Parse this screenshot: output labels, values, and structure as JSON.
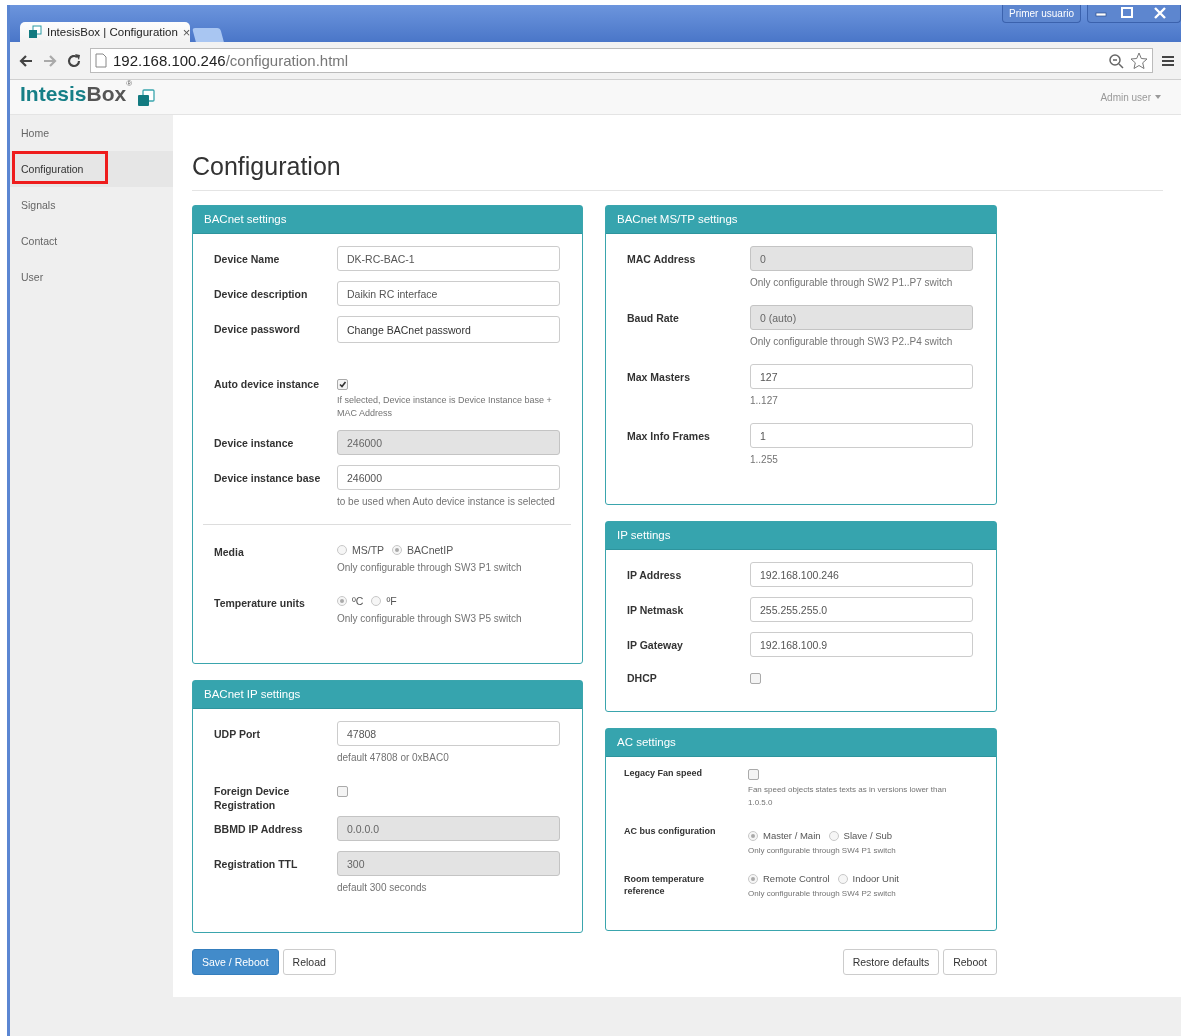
{
  "browser": {
    "tab_title": "IntesisBox | Configuration",
    "tab_close": "×",
    "profile": "Primer usuario",
    "url_host": "192.168.100.246",
    "url_path": "/configuration.html"
  },
  "header": {
    "brand_first": "Intesis",
    "brand_second": "Box",
    "brand_mark": "®",
    "user_menu": "Admin user"
  },
  "sidebar": {
    "items": [
      {
        "label": "Home",
        "selected": false,
        "highlighted": false
      },
      {
        "label": "Configuration",
        "selected": true,
        "highlighted": true
      },
      {
        "label": "Signals",
        "selected": false,
        "highlighted": false
      },
      {
        "label": "Contact",
        "selected": false,
        "highlighted": false
      },
      {
        "label": "User",
        "selected": false,
        "highlighted": false
      }
    ]
  },
  "page_title": "Configuration",
  "columns": [
    [
      {
        "title": "BACnet settings",
        "small_text": false,
        "rows": [
          {
            "kind": "input",
            "label": "Device Name",
            "value": "DK-RC-BAC-1",
            "disabled": false
          },
          {
            "kind": "input",
            "label": "Device description",
            "value": "Daikin RC interface",
            "disabled": false
          },
          {
            "kind": "button",
            "label": "Device password",
            "button": "Change BACnet password"
          },
          {
            "kind": "checkbox",
            "label": "Auto device instance",
            "checked": true,
            "help": "If selected, Device instance is Device Instance base + MAC Address"
          },
          {
            "kind": "input",
            "label": "Device instance",
            "value": "246000",
            "disabled": true
          },
          {
            "kind": "input",
            "label": "Device instance base",
            "value": "246000",
            "disabled": false,
            "help": "to be used when Auto device instance is selected"
          },
          {
            "kind": "divider"
          },
          {
            "kind": "radio",
            "label": "Media",
            "options": [
              {
                "label": "MS/TP",
                "selected": false
              },
              {
                "label": "BACnetIP",
                "selected": true
              }
            ],
            "help": "Only configurable through SW3 P1 switch"
          },
          {
            "kind": "radio",
            "label": "Temperature units",
            "options": [
              {
                "label": "ºC",
                "selected": true
              },
              {
                "label": "ºF",
                "selected": false
              }
            ],
            "help": "Only configurable through SW3 P5 switch"
          }
        ]
      },
      {
        "title": "BACnet IP settings",
        "small_text": false,
        "rows": [
          {
            "kind": "input",
            "label": "UDP Port",
            "value": "47808",
            "disabled": false,
            "help": "default 47808 or 0xBAC0"
          },
          {
            "kind": "checkbox",
            "label": "Foreign Device Registration",
            "checked": false
          },
          {
            "kind": "input",
            "label": "BBMD IP Address",
            "value": "0.0.0.0",
            "disabled": true
          },
          {
            "kind": "input",
            "label": "Registration TTL",
            "value": "300",
            "disabled": true,
            "help": "default 300 seconds"
          }
        ]
      }
    ],
    [
      {
        "title": "BACnet MS/TP settings",
        "small_text": false,
        "rows": [
          {
            "kind": "input",
            "label": "MAC Address",
            "value": "0",
            "disabled": true,
            "help": "Only configurable through SW2 P1..P7 switch"
          },
          {
            "kind": "input",
            "label": "Baud Rate",
            "value": "0 (auto)",
            "disabled": true,
            "help": "Only configurable through SW3 P2..P4 switch"
          },
          {
            "kind": "input",
            "label": "Max Masters",
            "value": "127",
            "disabled": false,
            "help": "1..127"
          },
          {
            "kind": "input",
            "label": "Max Info Frames",
            "value": "1",
            "disabled": false,
            "help": "1..255"
          }
        ]
      },
      {
        "title": "IP settings",
        "small_text": false,
        "rows": [
          {
            "kind": "input",
            "label": "IP Address",
            "value": "192.168.100.246",
            "disabled": false
          },
          {
            "kind": "input",
            "label": "IP Netmask",
            "value": "255.255.255.0",
            "disabled": false
          },
          {
            "kind": "input",
            "label": "IP Gateway",
            "value": "192.168.100.9",
            "disabled": false
          },
          {
            "kind": "checkbox",
            "label": "DHCP",
            "checked": false
          }
        ]
      },
      {
        "title": "AC settings",
        "small_text": true,
        "rows": [
          {
            "kind": "checkbox",
            "label": "Legacy Fan speed",
            "checked": false,
            "help": "Fan speed objects states texts as in versions lower than 1.0.5.0"
          },
          {
            "kind": "radio",
            "label": "AC bus configuration",
            "options": [
              {
                "label": "Master / Main",
                "selected": true
              },
              {
                "label": "Slave / Sub",
                "selected": false
              }
            ],
            "help": "Only configurable through SW4 P1 switch"
          },
          {
            "kind": "radio",
            "label": "Room temperature reference",
            "options": [
              {
                "label": "Remote Control",
                "selected": true
              },
              {
                "label": "Indoor Unit",
                "selected": false
              }
            ],
            "help": "Only configurable through SW4 P2 switch"
          }
        ]
      }
    ]
  ],
  "actions": {
    "left": [
      {
        "label": "Save / Reboot",
        "primary": true
      },
      {
        "label": "Reload",
        "primary": false
      }
    ],
    "right": [
      {
        "label": "Restore defaults",
        "primary": false
      },
      {
        "label": "Reboot",
        "primary": false
      }
    ]
  }
}
